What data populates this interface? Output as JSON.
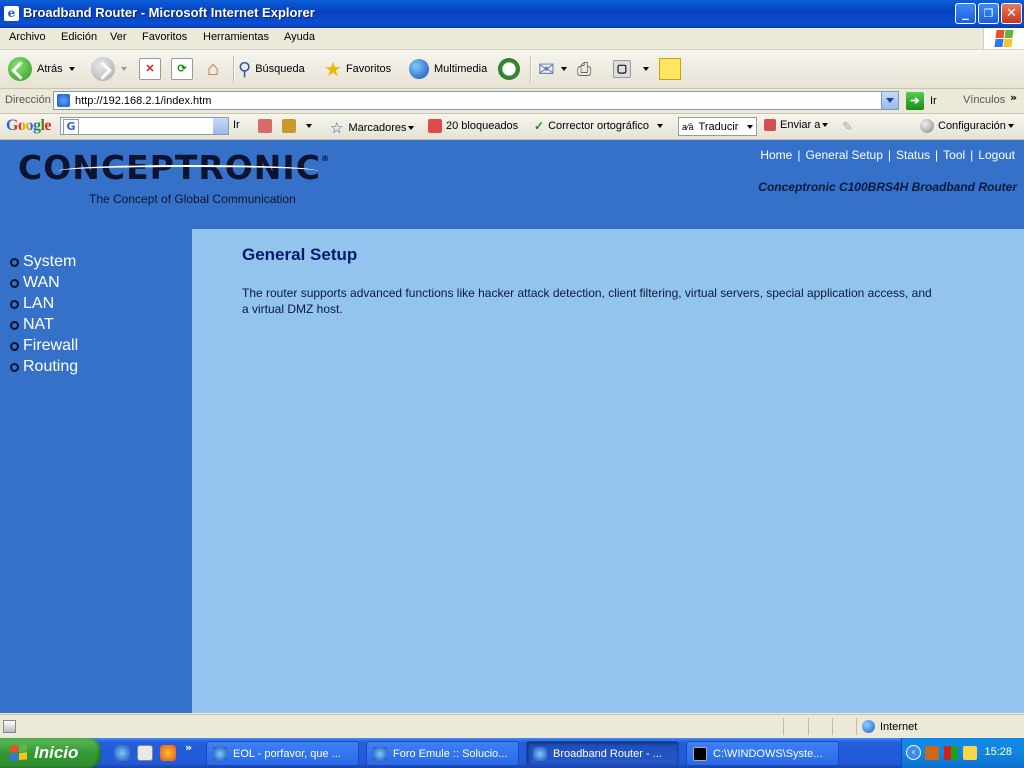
{
  "window": {
    "title": "Broadband Router - Microsoft Internet Explorer",
    "minimize": "_",
    "maximize": "❐",
    "close": "✕"
  },
  "menu": [
    "Archivo",
    "Edición",
    "Ver",
    "Favoritos",
    "Herramientas",
    "Ayuda"
  ],
  "toolbar": {
    "back": "Atrás",
    "search": "Búsqueda",
    "favorites": "Favoritos",
    "multimedia": "Multimedia"
  },
  "address": {
    "label": "Dirección",
    "url": "http://192.168.2.1/index.htm",
    "go": "Ir",
    "links": "Vínculos",
    "more": "»"
  },
  "google_toolbar": {
    "logo": "Google",
    "search_value": "",
    "go": "Ir",
    "bookmarks": "Marcadores",
    "blocked": "20 bloqueados",
    "spellcheck": "Corrector ortográfico",
    "translate": "Traducir",
    "send_to": "Enviar a",
    "settings": "Configuración"
  },
  "router_page": {
    "brand": "CONCEPTRONIC",
    "registered": "®",
    "tagline": "The Concept of Global Communication",
    "nav": [
      "Home",
      "General Setup",
      "Status",
      "Tool",
      "Logout"
    ],
    "separator": "|",
    "model": "Conceptronic C100BRS4H Broadband Router",
    "sidebar": [
      "System",
      "WAN",
      "LAN",
      "NAT",
      "Firewall",
      "Routing"
    ],
    "title": "General Setup",
    "description": "The router supports advanced functions like hacker attack detection, client filtering, virtual servers, special application access, and a virtual DMZ host."
  },
  "status_bar": {
    "zone": "Internet"
  },
  "taskbar": {
    "start": "Inicio",
    "more": "»",
    "tasks": [
      "EOL - porfavor, que ...",
      "Foro Emule :: Solucio...",
      "Broadband Router - ...",
      "C:\\WINDOWS\\Syste..."
    ],
    "clock": "15:28"
  },
  "colors": {
    "header_blue": "#3571c9",
    "content_blue": "#93c4ee",
    "title_navy": "#0a1870"
  }
}
